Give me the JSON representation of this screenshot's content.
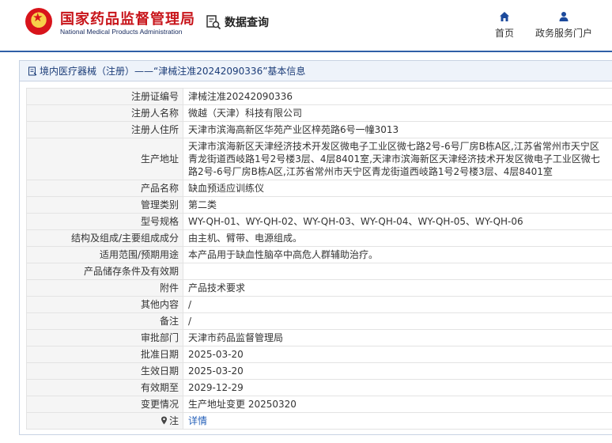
{
  "header": {
    "logo_cn": "国家药品监督管理局",
    "logo_en": "National Medical Products Administration",
    "search_label": "数据查询",
    "nav": [
      {
        "label": "首页",
        "icon": "home-icon"
      },
      {
        "label": "政务服务门户",
        "icon": "user-icon"
      }
    ]
  },
  "panel": {
    "title": "境内医疗器械（注册）——“津械注准20242090336”基本信息"
  },
  "rows": [
    {
      "key": "注册证编号",
      "value": "津械注准20242090336"
    },
    {
      "key": "注册人名称",
      "value": "微越（天津）科技有限公司"
    },
    {
      "key": "注册人住所",
      "value": "天津市滨海高新区华苑产业区梓苑路6号一幢3013"
    },
    {
      "key": "生产地址",
      "value": "天津市滨海新区天津经济技术开发区微电子工业区微七路2号-6号厂房B栋A区,江苏省常州市天宁区青龙街道西岐路1号2号楼3层、4层8401室,天津市滨海新区天津经济技术开发区微电子工业区微七路2号-6号厂房B栋A区,江苏省常州市天宁区青龙街道西岐路1号2号楼3层、4层8401室"
    },
    {
      "key": "产品名称",
      "value": "缺血预适应训练仪"
    },
    {
      "key": "管理类别",
      "value": "第二类"
    },
    {
      "key": "型号规格",
      "value": "WY-QH-01、WY-QH-02、WY-QH-03、WY-QH-04、WY-QH-05、WY-QH-06"
    },
    {
      "key": "结构及组成/主要组成成分",
      "value": "由主机、臂带、电源组成。"
    },
    {
      "key": "适用范围/预期用途",
      "value": "本产品用于缺血性脑卒中高危人群辅助治疗。"
    },
    {
      "key": "产品储存条件及有效期",
      "value": ""
    },
    {
      "key": "附件",
      "value": "产品技术要求"
    },
    {
      "key": "其他内容",
      "value": "/"
    },
    {
      "key": "备注",
      "value": "/"
    },
    {
      "key": "审批部门",
      "value": "天津市药品监督管理局"
    },
    {
      "key": "批准日期",
      "value": "2025-03-20"
    },
    {
      "key": "生效日期",
      "value": "2025-03-20"
    },
    {
      "key": "有效期至",
      "value": "2029-12-29"
    },
    {
      "key": "变更情况",
      "value": "生产地址变更 20250320"
    }
  ],
  "note_row": {
    "key": "注",
    "icon": "pin-icon",
    "link": "详情"
  },
  "colors": {
    "brand_red": "#c8151b",
    "brand_blue": "#1a2d60",
    "title_blue": "#1c3d78",
    "link_blue": "#2560b9",
    "rule_blue": "#2f5fa6"
  }
}
